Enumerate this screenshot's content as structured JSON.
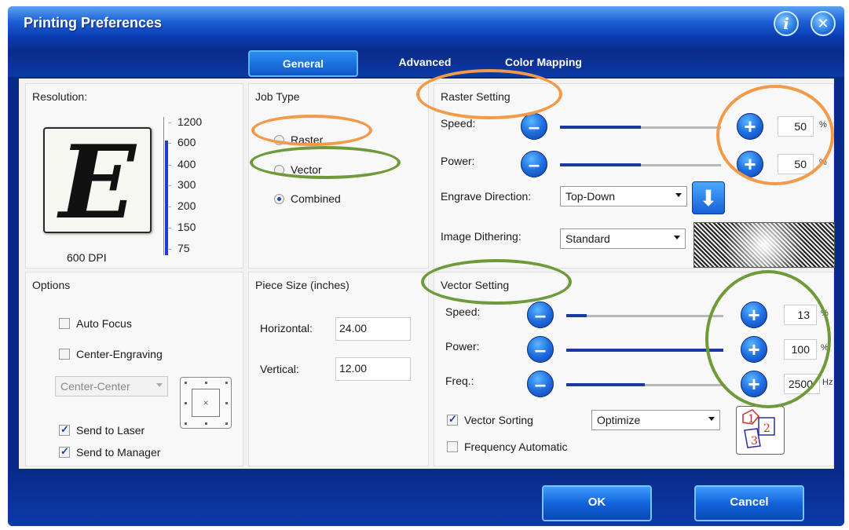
{
  "window": {
    "title": "Printing Preferences"
  },
  "tabs": [
    {
      "label": "General",
      "active": true
    },
    {
      "label": "Advanced",
      "active": false
    },
    {
      "label": "Color Mapping",
      "active": false
    }
  ],
  "resolution": {
    "title": "Resolution:",
    "preview_letter": "E",
    "dpi_label": "600 DPI",
    "ticks": [
      "1200",
      "600",
      "400",
      "300",
      "200",
      "150",
      "75"
    ],
    "selected_fraction": 0.83
  },
  "job_type": {
    "title": "Job Type",
    "options": [
      "Raster",
      "Vector",
      "Combined"
    ],
    "selected": "Combined"
  },
  "raster": {
    "title": "Raster Setting",
    "speed_label": "Speed:",
    "speed_value": "50",
    "speed_unit": "%",
    "speed_fraction": 0.5,
    "power_label": "Power:",
    "power_value": "50",
    "power_unit": "%",
    "power_fraction": 0.5,
    "direction_label": "Engrave Direction:",
    "direction_value": "Top-Down",
    "dithering_label": "Image Dithering:",
    "dithering_value": "Standard"
  },
  "options": {
    "title": "Options",
    "auto_focus": "Auto Focus",
    "center_engraving": "Center-Engraving",
    "position_value": "Center-Center",
    "position_marker": "×",
    "send_to_laser": "Send to Laser",
    "send_to_manager": "Send to Manager"
  },
  "piece_size": {
    "title": "Piece Size (inches)",
    "horizontal_label": "Horizontal:",
    "horizontal_value": "24.00",
    "vertical_label": "Vertical:",
    "vertical_value": "12.00"
  },
  "vector": {
    "title": "Vector Setting",
    "speed_label": "Speed:",
    "speed_value": "13",
    "speed_unit": "%",
    "speed_fraction": 0.13,
    "power_label": "Power:",
    "power_value": "100",
    "power_unit": "%",
    "power_fraction": 1.0,
    "freq_label": "Freq.:",
    "freq_value": "2500",
    "freq_unit": "Hz",
    "freq_fraction": 0.5,
    "sorting_label": "Vector Sorting",
    "sorting_value": "Optimize",
    "freq_auto_label": "Frequency Automatic",
    "sort_icon_digits": [
      "1",
      "2",
      "3"
    ]
  },
  "footer": {
    "ok_label": "OK",
    "cancel_label": "Cancel"
  },
  "annotation_colors": {
    "orange": "#f39a4a",
    "green": "#6f9a3a"
  }
}
